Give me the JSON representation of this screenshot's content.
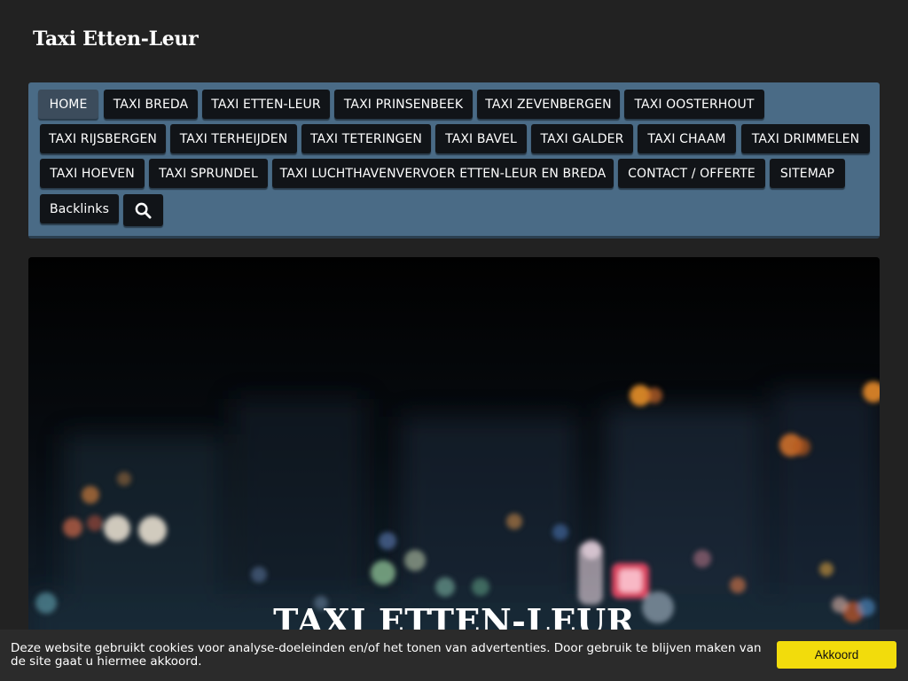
{
  "site": {
    "title": "Taxi Etten-Leur"
  },
  "nav": {
    "items": [
      {
        "label": "HOME",
        "active": true
      },
      {
        "label": "TAXI BREDA"
      },
      {
        "label": "TAXI ETTEN-LEUR"
      },
      {
        "label": "TAXI PRINSENBEEK"
      },
      {
        "label": "TAXI ZEVENBERGEN"
      },
      {
        "label": "TAXI OOSTERHOUT"
      },
      {
        "label": "TAXI RIJSBERGEN"
      },
      {
        "label": "TAXI TERHEIJDEN"
      },
      {
        "label": "TAXI TETERINGEN"
      },
      {
        "label": "TAXI BAVEL"
      },
      {
        "label": "TAXI GALDER"
      },
      {
        "label": "TAXI CHAAM"
      },
      {
        "label": "TAXI DRIMMELEN"
      },
      {
        "label": "TAXI HOEVEN"
      },
      {
        "label": "TAXI SPRUNDEL"
      },
      {
        "label": "TAXI LUCHTHAVENVERVOER ETTEN-LEUR EN BREDA"
      },
      {
        "label": "CONTACT / OFFERTE"
      },
      {
        "label": "SITEMAP"
      },
      {
        "label": "Backlinks"
      }
    ],
    "search_icon": "search-icon"
  },
  "hero": {
    "title": "TAXI ETTEN-LEUR"
  },
  "cookie": {
    "text": "Deze website gebruikt cookies voor analyse-doeleinden en/of het tonen van advertenties. Door gebruik te blijven maken van de site gaat u hiermee akkoord.",
    "accept_label": "Akkoord"
  },
  "colors": {
    "page_bg": "#222222",
    "nav_bg": "#4a6b86",
    "button_bg": "#111418",
    "accept_bg": "#f2dc0c"
  }
}
